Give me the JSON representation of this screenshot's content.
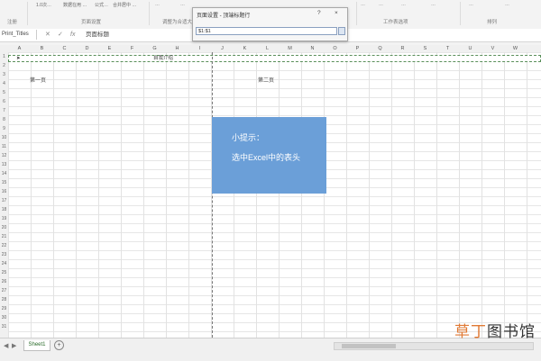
{
  "ribbon": {
    "top_items": [
      "1.0次…",
      "数据在用 …",
      "公式…",
      "合并居中 …",
      "…",
      "…",
      "…",
      "…",
      "…",
      "…",
      "…",
      "…"
    ],
    "groups": [
      "注册",
      "页面设置",
      "调整为合适大小",
      "工作表选项",
      "排列"
    ]
  },
  "formula_bar": {
    "name_box": "Print_Titles",
    "cancel_icon": "✕",
    "enter_icon": "✓",
    "fx_label": "fx",
    "content": "页面标题"
  },
  "columns": [
    "A",
    "B",
    "C",
    "D",
    "E",
    "F",
    "G",
    "H",
    "I",
    "J",
    "K",
    "L",
    "M",
    "N",
    "O",
    "P",
    "Q",
    "R",
    "S",
    "T",
    "U",
    "V",
    "W"
  ],
  "rows": [
    "1",
    "2",
    "3",
    "4",
    "5",
    "6",
    "7",
    "8",
    "9",
    "10",
    "11",
    "12",
    "13",
    "14",
    "15",
    "16",
    "17",
    "18",
    "19",
    "20",
    "21",
    "22",
    "23",
    "24",
    "25",
    "26",
    "27",
    "28",
    "29",
    "30",
    "31"
  ],
  "sheet": {
    "merged_header": "自我介绍",
    "page_label_1": "第一页",
    "page_label_2": "第二页"
  },
  "tip": {
    "line1": "小提示：",
    "line2": "选中Excel中的表头"
  },
  "dialog": {
    "title": "页面设置 - 顶端标题行",
    "help": "?",
    "close": "×",
    "input_value": "$1:$1"
  },
  "status": {
    "sheet_tab": "Sheet1",
    "add_sheet": "+",
    "nav_prev": "◀",
    "nav_next": "▶"
  },
  "watermark": {
    "part1": "草丁",
    "part2": "图书馆"
  }
}
